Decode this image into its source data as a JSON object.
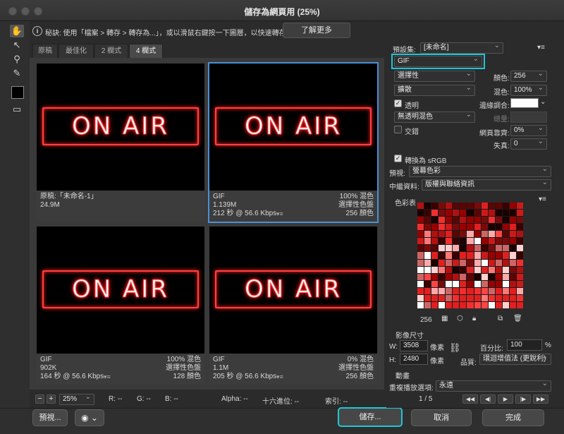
{
  "window": {
    "title": "儲存為網頁用 (25%)"
  },
  "hint": {
    "text": "秘訣: 使用「檔案 > 轉存 > 轉存為...」，或以滑鼠右鍵按一下圖層，以快速轉存資產",
    "learn_more": "了解更多"
  },
  "tabs": [
    "原稿",
    "最佳化",
    "2 欄式",
    "4 欄式"
  ],
  "image_text": "ON AIR",
  "panes": [
    {
      "format": "原稿:「未命名-1」",
      "size": "24.9M",
      "time": "",
      "r1": "",
      "r2": "",
      "r3": ""
    },
    {
      "format": "GIF",
      "size": "1.139M",
      "time": "212 秒 @ 56.6 Kbps",
      "r1": "100% 混色",
      "r2": "選擇性色盤",
      "r3": "256 顏色"
    },
    {
      "format": "GIF",
      "size": "902K",
      "time": "164 秒 @ 56.6 Kbps",
      "r1": "100% 混色",
      "r2": "選擇性色盤",
      "r3": "128 顏色"
    },
    {
      "format": "GIF",
      "size": "1.1M",
      "time": "205 秒 @ 56.6 Kbps",
      "r1": "0% 混色",
      "r2": "選擇性色盤",
      "r3": "256 顏色"
    }
  ],
  "status": {
    "zoom": "25%",
    "r": "R: --",
    "g": "G: --",
    "b": "B: --",
    "alpha": "Alpha: --",
    "hex": "十六進位: --",
    "index": "索引: --"
  },
  "bottom": {
    "preview": "預視...",
    "save": "儲存...",
    "cancel": "取消",
    "done": "完成"
  },
  "settings": {
    "preset_label": "預設集:",
    "preset_value": "[未命名]",
    "format": "GIF",
    "reduction": "選擇性",
    "colors_label": "顏色:",
    "colors": "256",
    "dither_algo": "擴散",
    "dither_label": "混色:",
    "dither": "100%",
    "transparency": "透明",
    "matte_label": "邊緣調合:",
    "no_trans_dither": "無透明混色",
    "amount_label": "總量:",
    "interlaced": "交錯",
    "websnap_label": "網頁靠齊:",
    "websnap": "0%",
    "lossy_label": "失真:",
    "lossy": "0",
    "convert_srgb": "轉換為 sRGB",
    "preview_label": "預視:",
    "preview_value": "螢幕色彩",
    "metadata_label": "中繼資料:",
    "metadata_value": "版權與聯絡資訊",
    "color_table": "色彩表",
    "color_count": "256",
    "image_size": "影像尺寸",
    "w_label": "W:",
    "w": "3508",
    "h_label": "H:",
    "h": "2480",
    "unit": "像素",
    "percent_label": "百分比:",
    "percent": "100",
    "percent_unit": "%",
    "quality_label": "品質:",
    "quality": "環迴增值法 (更銳利)",
    "animation": "動畫",
    "loop_label": "重複播放選項:",
    "loop": "永遠",
    "frame": "1 / 5"
  },
  "colors": {
    "accent": "#22c4d6",
    "selection": "#4a8fd6",
    "neon": "#ff3030"
  }
}
